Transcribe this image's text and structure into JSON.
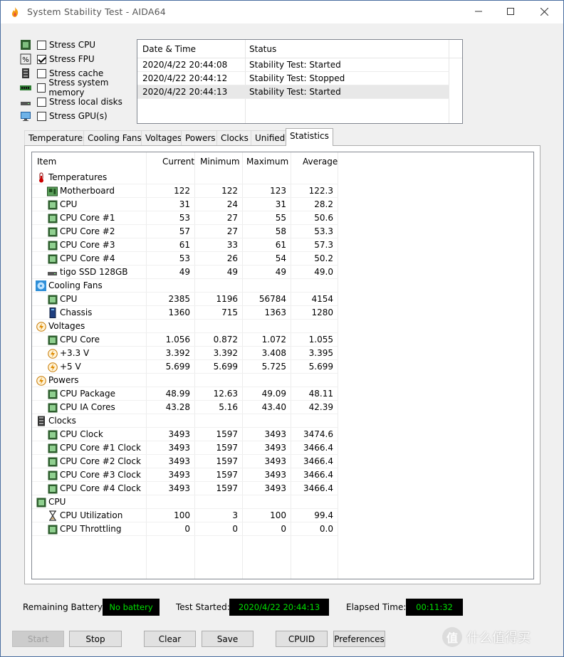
{
  "window": {
    "title": "System Stability Test - AIDA64"
  },
  "stress": [
    {
      "label": "Stress CPU",
      "checked": false,
      "icon": "cpu-chip-icon"
    },
    {
      "label": "Stress FPU",
      "checked": true,
      "icon": "fpu-percent-icon"
    },
    {
      "label": "Stress cache",
      "checked": false,
      "icon": "cache-icon"
    },
    {
      "label": "Stress system memory",
      "checked": false,
      "icon": "memory-module-icon"
    },
    {
      "label": "Stress local disks",
      "checked": false,
      "icon": "disk-drive-icon"
    },
    {
      "label": "Stress GPU(s)",
      "checked": false,
      "icon": "monitor-icon"
    }
  ],
  "log": {
    "headers": {
      "datetime": "Date & Time",
      "status": "Status"
    },
    "rows": [
      {
        "datetime": "2020/4/22 20:44:08",
        "status": "Stability Test: Started"
      },
      {
        "datetime": "2020/4/22 20:44:12",
        "status": "Stability Test: Stopped"
      },
      {
        "datetime": "2020/4/22 20:44:13",
        "status": "Stability Test: Started"
      }
    ]
  },
  "tabs": [
    "Temperatures",
    "Cooling Fans",
    "Voltages",
    "Powers",
    "Clocks",
    "Unified",
    "Statistics"
  ],
  "active_tab": "Statistics",
  "stats": {
    "headers": {
      "item": "Item",
      "current": "Current",
      "minimum": "Minimum",
      "maximum": "Maximum",
      "average": "Average"
    },
    "rows": [
      {
        "kind": "group",
        "icon": "thermometer-icon",
        "name": "Temperatures"
      },
      {
        "kind": "item",
        "icon": "motherboard-icon",
        "name": "Motherboard",
        "cur": "122",
        "min": "122",
        "max": "123",
        "avg": "122.3"
      },
      {
        "kind": "item",
        "icon": "cpu-chip-icon",
        "name": "CPU",
        "cur": "31",
        "min": "24",
        "max": "31",
        "avg": "28.2"
      },
      {
        "kind": "item",
        "icon": "cpu-chip-icon",
        "name": "CPU Core #1",
        "cur": "53",
        "min": "27",
        "max": "55",
        "avg": "50.6"
      },
      {
        "kind": "item",
        "icon": "cpu-chip-icon",
        "name": "CPU Core #2",
        "cur": "57",
        "min": "27",
        "max": "58",
        "avg": "53.3"
      },
      {
        "kind": "item",
        "icon": "cpu-chip-icon",
        "name": "CPU Core #3",
        "cur": "61",
        "min": "33",
        "max": "61",
        "avg": "57.3"
      },
      {
        "kind": "item",
        "icon": "cpu-chip-icon",
        "name": "CPU Core #4",
        "cur": "53",
        "min": "26",
        "max": "54",
        "avg": "50.2"
      },
      {
        "kind": "item",
        "icon": "ssd-drive-icon",
        "name": "tigo SSD 128GB",
        "cur": "49",
        "min": "49",
        "max": "49",
        "avg": "49.0"
      },
      {
        "kind": "group",
        "icon": "fan-icon",
        "name": "Cooling Fans"
      },
      {
        "kind": "item",
        "icon": "cpu-chip-icon",
        "name": "CPU",
        "cur": "2385",
        "min": "1196",
        "max": "56784",
        "avg": "4154"
      },
      {
        "kind": "item",
        "icon": "chassis-icon",
        "name": "Chassis",
        "cur": "1360",
        "min": "715",
        "max": "1363",
        "avg": "1280"
      },
      {
        "kind": "group",
        "icon": "bolt-icon",
        "name": "Voltages"
      },
      {
        "kind": "item",
        "icon": "cpu-chip-icon",
        "name": "CPU Core",
        "cur": "1.056",
        "min": "0.872",
        "max": "1.072",
        "avg": "1.055"
      },
      {
        "kind": "item",
        "icon": "bolt-icon",
        "name": "+3.3 V",
        "cur": "3.392",
        "min": "3.392",
        "max": "3.408",
        "avg": "3.395"
      },
      {
        "kind": "item",
        "icon": "bolt-icon",
        "name": "+5 V",
        "cur": "5.699",
        "min": "5.699",
        "max": "5.725",
        "avg": "5.699"
      },
      {
        "kind": "group",
        "icon": "bolt-icon",
        "name": "Powers"
      },
      {
        "kind": "item",
        "icon": "cpu-chip-icon",
        "name": "CPU Package",
        "cur": "48.99",
        "min": "12.63",
        "max": "49.09",
        "avg": "48.11"
      },
      {
        "kind": "item",
        "icon": "cpu-chip-icon",
        "name": "CPU IA Cores",
        "cur": "43.28",
        "min": "5.16",
        "max": "43.40",
        "avg": "42.39"
      },
      {
        "kind": "group",
        "icon": "clock-chip-icon",
        "name": "Clocks"
      },
      {
        "kind": "item",
        "icon": "cpu-chip-icon",
        "name": "CPU Clock",
        "cur": "3493",
        "min": "1597",
        "max": "3493",
        "avg": "3474.6"
      },
      {
        "kind": "item",
        "icon": "cpu-chip-icon",
        "name": "CPU Core #1 Clock",
        "cur": "3493",
        "min": "1597",
        "max": "3493",
        "avg": "3466.4"
      },
      {
        "kind": "item",
        "icon": "cpu-chip-icon",
        "name": "CPU Core #2 Clock",
        "cur": "3493",
        "min": "1597",
        "max": "3493",
        "avg": "3466.4"
      },
      {
        "kind": "item",
        "icon": "cpu-chip-icon",
        "name": "CPU Core #3 Clock",
        "cur": "3493",
        "min": "1597",
        "max": "3493",
        "avg": "3466.4"
      },
      {
        "kind": "item",
        "icon": "cpu-chip-icon",
        "name": "CPU Core #4 Clock",
        "cur": "3493",
        "min": "1597",
        "max": "3493",
        "avg": "3466.4"
      },
      {
        "kind": "group",
        "icon": "cpu-chip-icon",
        "name": "CPU"
      },
      {
        "kind": "item",
        "icon": "hourglass-icon",
        "name": "CPU Utilization",
        "cur": "100",
        "min": "3",
        "max": "100",
        "avg": "99.4"
      },
      {
        "kind": "item",
        "icon": "cpu-chip-icon",
        "name": "CPU Throttling",
        "cur": "0",
        "min": "0",
        "max": "0",
        "avg": "0.0"
      }
    ]
  },
  "status": {
    "battery_label": "Remaining Battery:",
    "battery_value": "No battery",
    "started_label": "Test Started:",
    "started_value": "2020/4/22 20:44:13",
    "elapsed_label": "Elapsed Time:",
    "elapsed_value": "00:11:32"
  },
  "buttons": {
    "start": "Start",
    "stop": "Stop",
    "clear": "Clear",
    "save": "Save",
    "cpuid": "CPUID",
    "preferences": "Preferences"
  },
  "watermark": {
    "logo": "值",
    "text": "什么值得买"
  },
  "colors": {
    "lcd_bg": "#000000",
    "lcd_text": "#00e000",
    "chip_green": "#2e7d32",
    "selected_row": "#e8e8e8"
  }
}
